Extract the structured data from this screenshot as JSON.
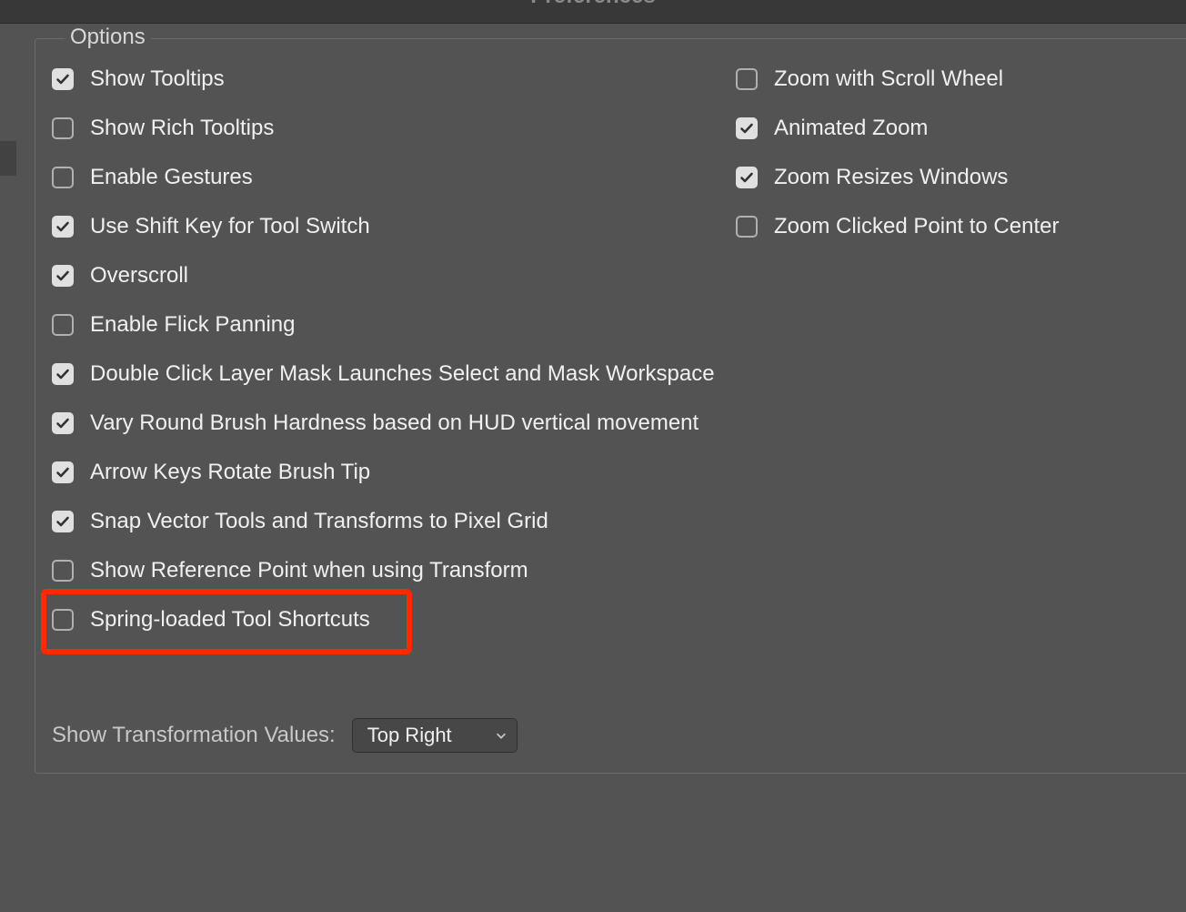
{
  "window": {
    "title": "Preferences"
  },
  "options": {
    "legend": "Options",
    "left": [
      {
        "label": "Show Tooltips",
        "checked": true,
        "highlighted": false
      },
      {
        "label": "Show Rich Tooltips",
        "checked": false,
        "highlighted": false
      },
      {
        "label": "Enable Gestures",
        "checked": false,
        "highlighted": false
      },
      {
        "label": "Use Shift Key for Tool Switch",
        "checked": true,
        "highlighted": false
      },
      {
        "label": "Overscroll",
        "checked": true,
        "highlighted": false
      },
      {
        "label": "Enable Flick Panning",
        "checked": false,
        "highlighted": false
      },
      {
        "label": "Double Click Layer Mask Launches Select and Mask Workspace",
        "checked": true,
        "highlighted": false
      },
      {
        "label": "Vary Round Brush Hardness based on HUD vertical movement",
        "checked": true,
        "highlighted": false
      },
      {
        "label": "Arrow Keys Rotate Brush Tip",
        "checked": true,
        "highlighted": false
      },
      {
        "label": "Snap Vector Tools and Transforms to Pixel Grid",
        "checked": true,
        "highlighted": false
      },
      {
        "label": "Show Reference Point when using Transform",
        "checked": false,
        "highlighted": false
      },
      {
        "label": "Spring-loaded Tool Shortcuts",
        "checked": false,
        "highlighted": true
      }
    ],
    "right": [
      {
        "label": "Zoom with Scroll Wheel",
        "checked": false
      },
      {
        "label": "Animated Zoom",
        "checked": true
      },
      {
        "label": "Zoom Resizes Windows",
        "checked": true
      },
      {
        "label": "Zoom Clicked Point to Center",
        "checked": false
      }
    ]
  },
  "transformation": {
    "label": "Show Transformation Values:",
    "value": "Top Right"
  }
}
